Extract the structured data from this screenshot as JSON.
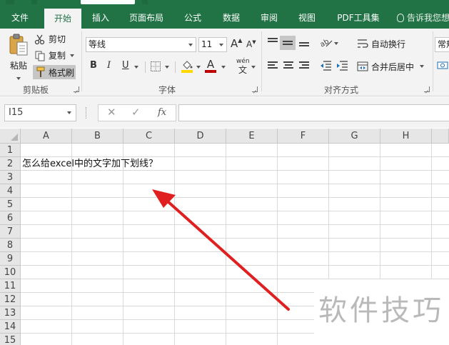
{
  "ribbon_tabs": {
    "file": "文件",
    "home": "开始",
    "insert": "插入",
    "page_layout": "页面布局",
    "formulas": "公式",
    "data": "数据",
    "review": "审阅",
    "view": "视图",
    "pdf": "PDF工具集",
    "tell_me": "告诉我您想"
  },
  "clipboard": {
    "paste": "粘贴",
    "cut": "剪切",
    "copy": "复制",
    "format_painter": "格式刷",
    "group_label": "剪贴板"
  },
  "font": {
    "name": "等线",
    "size": "11",
    "bold": "B",
    "italic": "I",
    "underline": "U",
    "grow": "A",
    "shrink": "A",
    "font_color": "A",
    "phonetic_top": "wén",
    "phonetic_bottom": "文",
    "group_label": "字体"
  },
  "alignment": {
    "wrap_text": "自动换行",
    "merge_center": "合并后居中",
    "group_label": "对齐方式"
  },
  "number": {
    "format": "常规"
  },
  "formula_bar": {
    "name_box": "I15",
    "fx": "fx",
    "content": ""
  },
  "sheet": {
    "columns": [
      "A",
      "B",
      "C",
      "D",
      "E",
      "F",
      "G",
      "H"
    ],
    "rows": [
      "1",
      "2",
      "3",
      "4",
      "5",
      "6",
      "7",
      "8",
      "9",
      "10",
      "11",
      "12",
      "13",
      "14",
      "15"
    ],
    "cell_A2": "怎么给excel中的文字加下划线？"
  },
  "colors": {
    "ribbon_green": "#217346",
    "arrow_red": "#e02020",
    "font_color_bar": "#c00000",
    "highlight_yellow": "#ffd800"
  },
  "watermark": "软件技巧"
}
